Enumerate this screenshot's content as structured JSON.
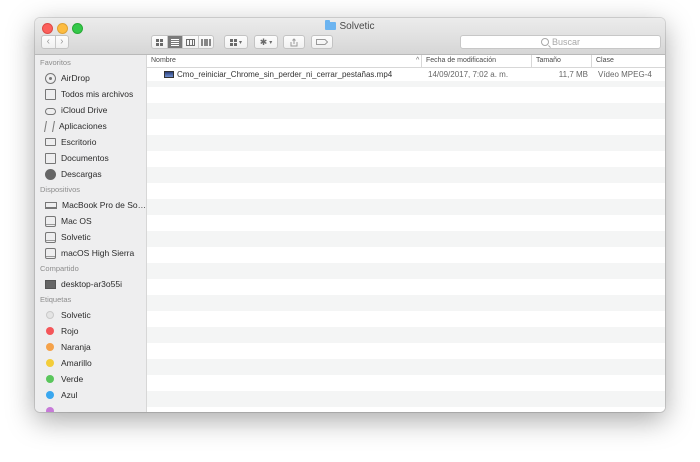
{
  "window": {
    "title": "Solvetic",
    "search_placeholder": "Buscar"
  },
  "toolbar": {
    "back": "‹",
    "forward": "›",
    "arrange_caret": "▾",
    "action_gear": "✱",
    "action_caret": "▾"
  },
  "sidebar": {
    "sections": [
      {
        "title": "Favoritos",
        "items": [
          {
            "label": "AirDrop",
            "icon": "airdrop-icon"
          },
          {
            "label": "Todos mis archivos",
            "icon": "all-files-icon"
          },
          {
            "label": "iCloud Drive",
            "icon": "cloud-icon"
          },
          {
            "label": "Aplicaciones",
            "icon": "applications-icon"
          },
          {
            "label": "Escritorio",
            "icon": "desktop-icon"
          },
          {
            "label": "Documentos",
            "icon": "document-icon"
          },
          {
            "label": "Descargas",
            "icon": "download-icon"
          }
        ]
      },
      {
        "title": "Dispositivos",
        "items": [
          {
            "label": "MacBook Pro de So…",
            "icon": "laptop-icon"
          },
          {
            "label": "Mac OS",
            "icon": "disk-icon"
          },
          {
            "label": "Solvetic",
            "icon": "disk-icon"
          },
          {
            "label": "macOS High Sierra",
            "icon": "disk-icon"
          }
        ]
      },
      {
        "title": "Compartido",
        "items": [
          {
            "label": "desktop-ar3o55i",
            "icon": "shared-computer-icon"
          }
        ]
      },
      {
        "title": "Etiquetas",
        "items": [
          {
            "label": "Solvetic",
            "color": "#e4e4e4"
          },
          {
            "label": "Rojo",
            "color": "#f4565a"
          },
          {
            "label": "Naranja",
            "color": "#f5a24a"
          },
          {
            "label": "Amarillo",
            "color": "#f3cd3a"
          },
          {
            "label": "Verde",
            "color": "#5ac65c"
          },
          {
            "label": "Azul",
            "color": "#3aa7ef"
          }
        ]
      }
    ]
  },
  "columns": {
    "name": "Nombre",
    "date": "Fecha de modificación",
    "size": "Tamaño",
    "kind": "Clase",
    "sort_indicator": "^"
  },
  "files": [
    {
      "name": "Cmo_reiniciar_Chrome_sin_perder_ni_cerrar_pestañas.mp4",
      "date": "14/09/2017, 7:02 a. m.",
      "size": "11,7 MB",
      "kind": "Vídeo MPEG-4"
    }
  ]
}
